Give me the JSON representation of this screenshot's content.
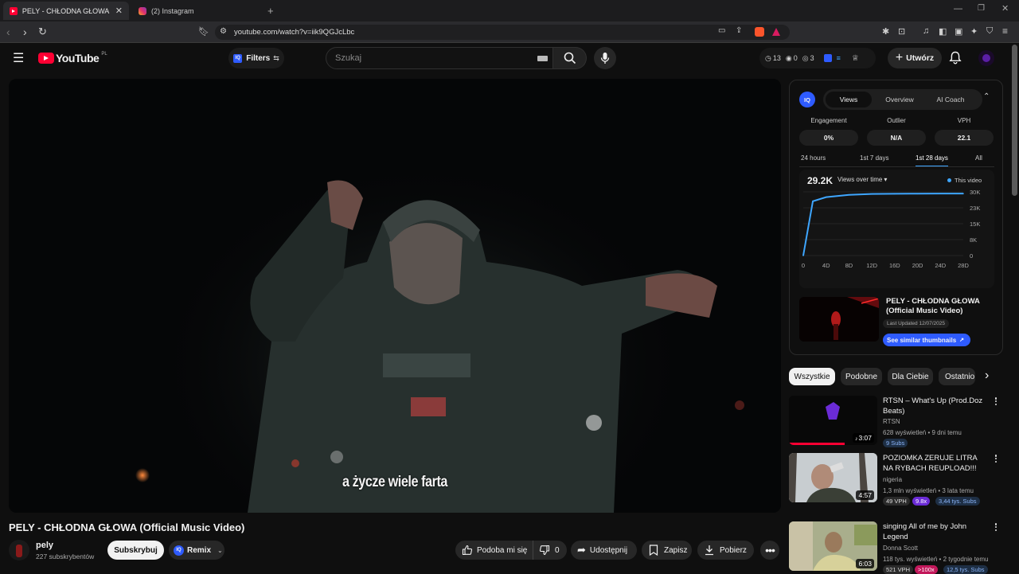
{
  "browser": {
    "tabs": [
      {
        "title": "PELY - CHŁODNA GŁOWA (Offic",
        "active": true
      },
      {
        "title": "(2) Instagram",
        "active": false
      }
    ],
    "url": "youtube.com/watch?v=iik9QGJcLbc"
  },
  "masthead": {
    "logo_text": "YouTube",
    "country": "PL",
    "filters_label": "Filters",
    "search_placeholder": "Szukaj",
    "stats": {
      "a": "13",
      "b": "0",
      "c": "3"
    },
    "create_label": "Utwórz"
  },
  "video": {
    "subtitle": "a życze wiele farta",
    "title": "PELY - CHŁODNA GŁOWA (Official Music Video)",
    "channel": "pely",
    "subscribers": "227 subskrybentów",
    "subscribe_label": "Subskrybuj",
    "remix_label": "Remix",
    "like_label": "Podoba mi się",
    "dislike_count": "0",
    "share_label": "Udostępnij",
    "save_label": "Zapisz",
    "download_label": "Pobierz"
  },
  "vidiq": {
    "logo": "IQ",
    "tabs": [
      "Views",
      "Overview",
      "AI Coach"
    ],
    "metrics": [
      {
        "label": "Engagement",
        "value": "0%"
      },
      {
        "label": "Outlier",
        "value": "N/A"
      },
      {
        "label": "VPH",
        "value": "22.1"
      }
    ],
    "periods": [
      "24 hours",
      "1st 7 days",
      "1st 28 days",
      "All"
    ],
    "active_period": "1st 28 days",
    "total": "29.2K",
    "views_dropdown": "Views over time",
    "legend": "This video",
    "card": {
      "title": "PELY - CHŁODNA GŁOWA (Official Music Video)",
      "updated": "Last Updated 12/07/2025",
      "button": "See similar thumbnails"
    }
  },
  "chart_data": {
    "type": "line",
    "x": [
      "0",
      "4D",
      "8D",
      "12D",
      "16D",
      "20D",
      "24D",
      "28D"
    ],
    "series": [
      {
        "values": [
          0,
          27500,
          28600,
          29000,
          29100,
          29150,
          29200,
          29200
        ]
      }
    ],
    "yticks": [
      "30K",
      "23K",
      "15K",
      "8K",
      "0"
    ],
    "ylim": [
      0,
      30000
    ],
    "color": "#3ea6ff"
  },
  "chips": [
    "Wszystkie",
    "Podobne",
    "Dla Ciebie",
    "Ostatnio"
  ],
  "recommendations": [
    {
      "title": "RTSN – What's Up (Prod.Doz Beats)",
      "channel": "RTSN",
      "meta": "628 wyświetleń • 9 dni temu",
      "duration": "3:07",
      "badges": [
        "9 Subs"
      ]
    },
    {
      "title": "POZIOMKA ZERUJE LITRA NA RYBACH REUPLOAD!!!",
      "channel": "nigeria",
      "meta": "1,3 mln wyświetleń • 3 lata temu",
      "duration": "4:57",
      "badges": [
        "49 VPH",
        "9.8x",
        "3,44 tys. Subs"
      ]
    },
    {
      "title": "singing All of me by John Legend",
      "channel": "Donna Scott",
      "meta": "118 tys. wyświetleń • 2 tygodnie temu",
      "duration": "6:03",
      "badges": [
        "521 VPH",
        ">100x",
        "12,5 tys. Subs"
      ]
    }
  ]
}
